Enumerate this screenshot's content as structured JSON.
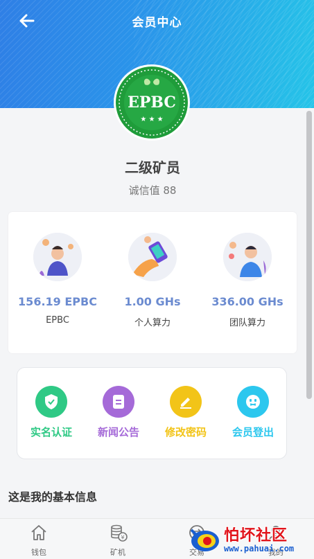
{
  "header": {
    "title": "会员中心"
  },
  "logo": {
    "text": "EPBC"
  },
  "member": {
    "level": "二级矿员",
    "credit_label": "诚信值 88"
  },
  "stats": [
    {
      "value": "156.19 EPBC",
      "label": "EPBC"
    },
    {
      "value": "1.00 GHs",
      "label": "个人算力"
    },
    {
      "value": "336.00 GHs",
      "label": "团队算力"
    }
  ],
  "menu": [
    {
      "label": "实名认证",
      "color": "#2fc985",
      "icon": "shield-icon"
    },
    {
      "label": "新闻公告",
      "color": "#a56ad8",
      "icon": "document-icon"
    },
    {
      "label": "修改密码",
      "color": "#f2c418",
      "icon": "edit-icon"
    },
    {
      "label": "会员登出",
      "color": "#2cc7ee",
      "icon": "logout-face-icon"
    }
  ],
  "section": {
    "title": "这是我的基本信息"
  },
  "tabs": [
    {
      "label": "钱包",
      "icon": "home-icon"
    },
    {
      "label": "矿机",
      "icon": "coin-stack-icon"
    },
    {
      "label": "交易",
      "icon": "exchange-icon"
    },
    {
      "label": "我的",
      "icon": "user-icon"
    }
  ],
  "watermark": {
    "text": "怕坏社区",
    "url": "www.pahuai.com"
  }
}
